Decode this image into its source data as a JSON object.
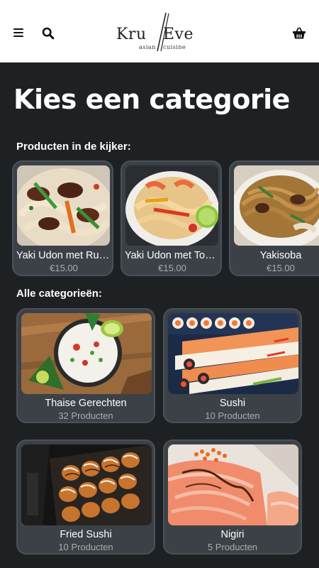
{
  "header": {
    "menu_icon": "hamburger-menu-icon",
    "search_icon": "search-icon",
    "cart_icon": "shopping-basket-icon",
    "logo": {
      "word_left": "Kru",
      "word_right": "Eve",
      "sub_left": "asian",
      "sub_right": "cuisine"
    }
  },
  "page_title": "Kies een categorie",
  "featured": {
    "label": "Producten in de kijker:",
    "items": [
      {
        "name": "Yaki Udon met Rundsvlees",
        "price": "€15.00"
      },
      {
        "name": "Yaki Udon met Tonijn",
        "price": "€15.00"
      },
      {
        "name": "Yakisoba",
        "price": "€15.00"
      }
    ]
  },
  "categories": {
    "label": "Alle categorieën:",
    "items": [
      {
        "name": "Thaise Gerechten",
        "count": "32 Producten"
      },
      {
        "name": "Sushi",
        "count": "10 Producten"
      },
      {
        "name": "Fried Sushi",
        "count": "10 Producten"
      },
      {
        "name": "Nigiri",
        "count": "5 Producten"
      }
    ]
  },
  "colors": {
    "background": "#1e2124",
    "card": "#3b4147",
    "header": "#ffffff",
    "muted_text": "#a9adb2"
  }
}
